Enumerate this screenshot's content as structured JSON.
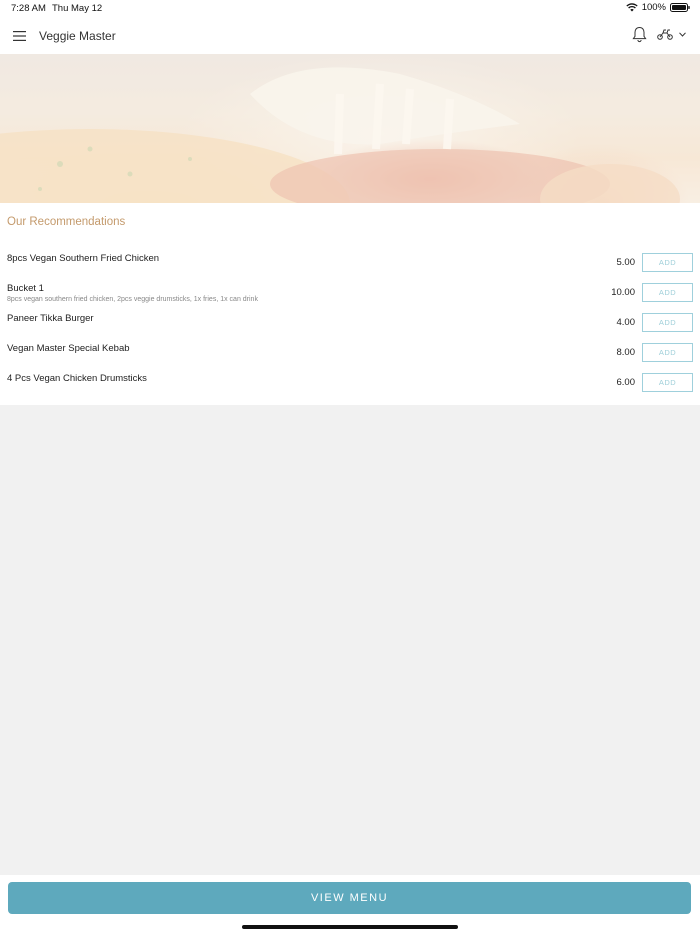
{
  "status_bar": {
    "time": "7:28 AM",
    "date": "Thu May 12",
    "battery": "100%"
  },
  "app_bar": {
    "title": "Veggie Master",
    "icons": [
      "menu-icon",
      "bell-icon",
      "scooter-icon",
      "chevron-down-icon"
    ]
  },
  "recommendations": {
    "title": "Our Recommendations",
    "add_label": "ADD",
    "items": [
      {
        "name": "8pcs Vegan Southern Fried Chicken",
        "description": "",
        "price": "5.00"
      },
      {
        "name": "Bucket 1",
        "description": "8pcs vegan southern fried chicken, 2pcs veggie drumsticks, 1x fries, 1x can drink",
        "price": "10.00"
      },
      {
        "name": "Paneer Tikka Burger",
        "description": "",
        "price": "4.00"
      },
      {
        "name": "Vegan Master Special Kebab",
        "description": "",
        "price": "8.00"
      },
      {
        "name": "4 Pcs Vegan Chicken Drumsticks",
        "description": "",
        "price": "6.00"
      }
    ]
  },
  "footer": {
    "view_menu_label": "VIEW MENU"
  },
  "colors": {
    "accent": "#5ea9bd",
    "section_title": "#c49a6c",
    "add_border": "#9fd0dc",
    "background": "#f1f1f1"
  }
}
